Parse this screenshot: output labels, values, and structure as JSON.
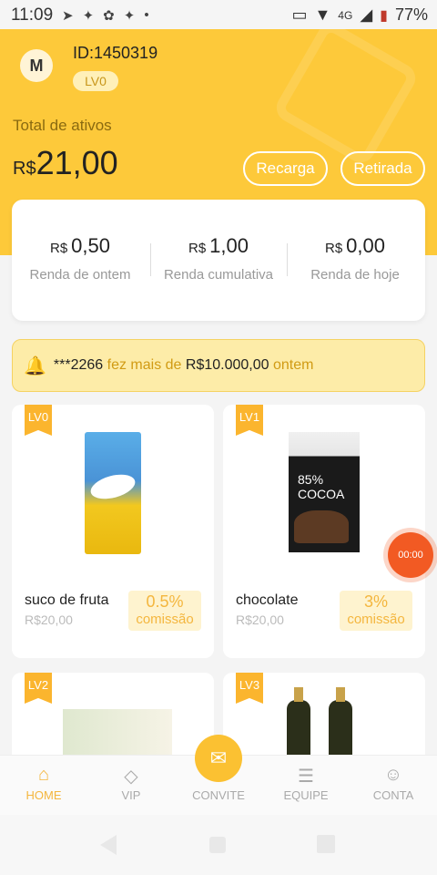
{
  "status": {
    "time": "11:09",
    "network": "4G",
    "battery": "77%"
  },
  "account": {
    "id": "ID:1450319",
    "level": "LV0"
  },
  "balance": {
    "label": "Total de ativos",
    "currency": "R$",
    "amount": "21,00"
  },
  "actions": {
    "recharge": "Recarga",
    "withdraw": "Retirada"
  },
  "stats": [
    {
      "currency": "R$",
      "value": "0,50",
      "label": "Renda de ontem"
    },
    {
      "currency": "R$",
      "value": "1,00",
      "label": "Renda cumulativa"
    },
    {
      "currency": "R$",
      "value": "0,00",
      "label": "Renda de hoje"
    }
  ],
  "notice": {
    "user": "***2266",
    "mid": " fez mais de ",
    "amount": "R$10.000,00",
    "tail": " ontem"
  },
  "products": [
    {
      "level": "LV0",
      "name": "suco de fruta",
      "price": "R$20,00",
      "commission": "0.5%",
      "commission_label": "comissão"
    },
    {
      "level": "LV1",
      "name": "chocolate",
      "price": "R$20,00",
      "commission": "3%",
      "commission_label": "comissão"
    },
    {
      "level": "LV2"
    },
    {
      "level": "LV3"
    }
  ],
  "timer": "00:00",
  "tabs": [
    {
      "label": "HOME",
      "icon": "home-icon"
    },
    {
      "label": "VIP",
      "icon": "diamond-icon"
    },
    {
      "label": "CONVITE",
      "icon": "envelope-icon"
    },
    {
      "label": "EQUIPE",
      "icon": "layers-icon"
    },
    {
      "label": "CONTA",
      "icon": "person-icon"
    }
  ],
  "colors": {
    "brand": "#fdc93a",
    "accent": "#f4b63e",
    "timer": "#f25a23"
  }
}
